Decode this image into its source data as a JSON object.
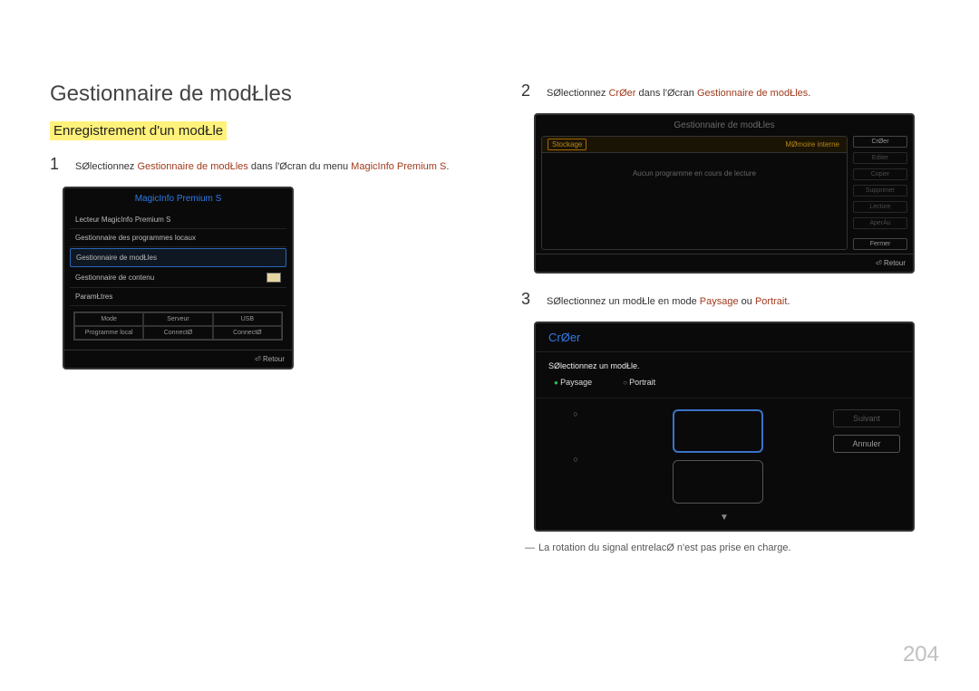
{
  "page": {
    "title": "Gestionnaire de modŁles",
    "subtitle": "Enregistrement d'un modŁle",
    "pagenum": "204"
  },
  "steps": {
    "s1": {
      "num": "1",
      "pre": "SØlectionnez ",
      "link1": "Gestionnaire de modŁles",
      "mid": " dans l'Øcran du menu ",
      "link2": "MagicInfo Premium S",
      "post": "."
    },
    "s2": {
      "num": "2",
      "pre": "SØlectionnez ",
      "link1": "CrØer",
      "mid": " dans l'Øcran ",
      "link2": "Gestionnaire de modŁles",
      "post": "."
    },
    "s3": {
      "num": "3",
      "pre": "SØlectionnez un modŁle en mode ",
      "link1": "Paysage",
      "mid": " ou ",
      "link2": "Portrait",
      "post": "."
    }
  },
  "note": {
    "dash": "―",
    "text": "La rotation du signal entrelacØ n'est pas prise en charge."
  },
  "shot1": {
    "title": "MagicInfo Premium S",
    "items": [
      "Lecteur MagicInfo Premium S",
      "Gestionnaire des programmes locaux",
      "Gestionnaire de modŁles",
      "Gestionnaire de contenu",
      "ParamŁtres"
    ],
    "cells": [
      "Mode",
      "Serveur",
      "USB",
      "Programme local",
      "ConnectØ",
      "ConnectØ"
    ],
    "retour": "Retour"
  },
  "shot2": {
    "title": "Gestionnaire de modŁles",
    "head_left": "Stockage",
    "head_right": "MØmoire interne",
    "body": "Aucun programme en cours de lecture",
    "buttons": [
      "CrØer",
      "Editer",
      "Copier",
      "Supprimer",
      "Lecture",
      "AperÁu",
      "Fermer"
    ],
    "retour": "Retour"
  },
  "shot3": {
    "title": "CrØer",
    "sub": "SØlectionnez un modŁle.",
    "opt1": "Paysage",
    "opt2": "Portrait",
    "btn_next": "Suivant",
    "btn_cancel": "Annuler"
  }
}
